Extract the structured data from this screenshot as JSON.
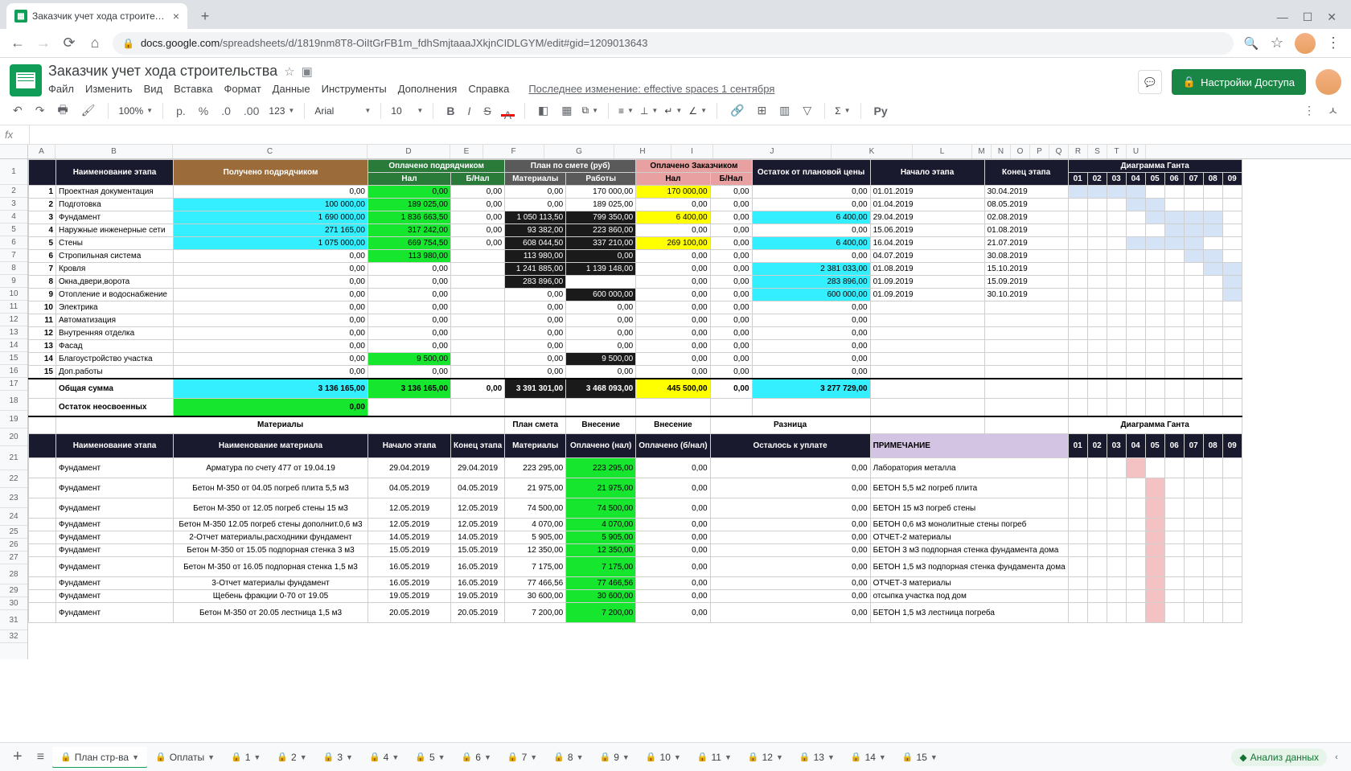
{
  "browser": {
    "tab_title": "Заказчик учет хода строительст",
    "url_host": "docs.google.com",
    "url_path": "/spreadsheets/d/1819nm8T8-OiItGrFB1m_fdhSmjtaaaJXkjnCIDLGYM/edit#gid=1209013643"
  },
  "doc": {
    "title": "Заказчик учет хода строительства",
    "menus": [
      "Файл",
      "Изменить",
      "Вид",
      "Вставка",
      "Формат",
      "Данные",
      "Инструменты",
      "Дополнения",
      "Справка"
    ],
    "last_edit": "Последнее изменение: effective spaces 1 сентября",
    "share": "Настройки Доступа"
  },
  "toolbar": {
    "zoom": "100%",
    "font": "Arial",
    "size": "10"
  },
  "cols": {
    "A": 34,
    "B": 146,
    "C": 242,
    "D": 103,
    "E": 41,
    "F": 76,
    "G": 87,
    "H": 71,
    "I": 52,
    "J": 147,
    "K": 101,
    "L": 74
  },
  "gantt_hdr": [
    "01",
    "02",
    "03",
    "04",
    "05",
    "06",
    "07",
    "08",
    "09"
  ],
  "gantt_w": 24,
  "header1": {
    "name": "Наименование этапа",
    "recv": "Получено подрядчиком",
    "paidc": "Оплачено подрядчиком",
    "plan": "План по смете (руб)",
    "paidz": "Оплачено Заказчиком",
    "rest": "Остаток от плановой цены",
    "start": "Начало этапа",
    "end": "Конец этапа",
    "gantt": "Диаграмма Ганта"
  },
  "header2": {
    "nal": "Нал",
    "bnal": "Б/Нал",
    "mat": "Материалы",
    "rab": "Работы"
  },
  "rows": [
    {
      "n": "1",
      "name": "Проектная документация",
      "recv": "0,00",
      "d": "0,00",
      "e": "0,00",
      "f": "0,00",
      "g": "170 000,00",
      "h": "170 000,00",
      "i": "0,00",
      "j": "0,00",
      "k": "01.01.2019",
      "l": "30.04.2019",
      "g1": [
        1,
        2,
        3,
        4
      ],
      "recv_c": "",
      "d_c": "c-green",
      "h_c": "c-yellow",
      "j_c": ""
    },
    {
      "n": "2",
      "name": "Подготовка",
      "recv": "100 000,00",
      "d": "189 025,00",
      "e": "0,00",
      "f": "0,00",
      "g": "189 025,00",
      "h": "0,00",
      "i": "0,00",
      "j": "0,00",
      "k": "01.04.2019",
      "l": "08.05.2019",
      "g1": [
        4,
        5
      ],
      "recv_c": "c-cyan",
      "d_c": "c-green",
      "h_c": "",
      "j_c": ""
    },
    {
      "n": "3",
      "name": "Фундамент",
      "recv": "1 690 000,00",
      "d": "1 836 663,50",
      "e": "0,00",
      "f": "1 050 113,50",
      "g": "799 350,00",
      "h": "6 400,00",
      "i": "0,00",
      "j": "6 400,00",
      "k": "29.04.2019",
      "l": "02.08.2019",
      "g1": [
        5,
        6,
        7,
        8
      ],
      "recv_c": "c-cyan",
      "d_c": "c-green",
      "f_c": "c-black",
      "g_c": "c-black",
      "h_c": "c-yellow",
      "j_c": "c-cyan"
    },
    {
      "n": "4",
      "name": "Наружные инженерные сети",
      "recv": "271 165,00",
      "d": "317 242,00",
      "e": "0,00",
      "f": "93 382,00",
      "g": "223 860,00",
      "h": "0,00",
      "i": "0,00",
      "j": "0,00",
      "k": "15.06.2019",
      "l": "01.08.2019",
      "g1": [
        6,
        7,
        8
      ],
      "recv_c": "c-cyan",
      "d_c": "c-green",
      "f_c": "c-black",
      "g_c": "c-black",
      "h_c": "",
      "j_c": ""
    },
    {
      "n": "5",
      "name": "Стены",
      "recv": "1 075 000,00",
      "d": "669 754,50",
      "e": "0,00",
      "f": "608 044,50",
      "g": "337 210,00",
      "h": "269 100,00",
      "i": "0,00",
      "j": "6 400,00",
      "k": "16.04.2019",
      "l": "21.07.2019",
      "g1": [
        4,
        5,
        6,
        7
      ],
      "recv_c": "c-cyan",
      "d_c": "c-green",
      "f_c": "c-black",
      "g_c": "c-black",
      "h_c": "c-yellow",
      "j_c": "c-cyan"
    },
    {
      "n": "6",
      "name": "Стропильная система",
      "recv": "0,00",
      "d": "113 980,00",
      "e": "",
      "f": "113 980,00",
      "g": "0,00",
      "h": "0,00",
      "i": "0,00",
      "j": "0,00",
      "k": "04.07.2019",
      "l": "30.08.2019",
      "g1": [
        7,
        8
      ],
      "recv_c": "",
      "d_c": "c-green",
      "f_c": "c-black",
      "g_c": "c-black",
      "h_c": "",
      "j_c": ""
    },
    {
      "n": "7",
      "name": "Кровля",
      "recv": "0,00",
      "d": "0,00",
      "e": "",
      "f": "1 241 885,00",
      "g": "1 139 148,00",
      "h": "0,00",
      "i": "0,00",
      "j": "2 381 033,00",
      "k": "01.08.2019",
      "l": "15.10.2019",
      "g1": [
        8,
        9
      ],
      "recv_c": "",
      "d_c": "",
      "f_c": "c-black",
      "g_c": "c-black",
      "h_c": "",
      "j_c": "c-cyan"
    },
    {
      "n": "8",
      "name": "Окна,двери,ворота",
      "recv": "0,00",
      "d": "0,00",
      "e": "",
      "f": "283 896,00",
      "g": "",
      "h": "0,00",
      "i": "0,00",
      "j": "283 896,00",
      "k": "01.09.2019",
      "l": "15.09.2019",
      "g1": [
        9
      ],
      "recv_c": "",
      "d_c": "",
      "f_c": "c-black",
      "g_c": "",
      "h_c": "",
      "j_c": "c-cyan"
    },
    {
      "n": "9",
      "name": "Отопление и водоснабжение",
      "recv": "0,00",
      "d": "0,00",
      "e": "",
      "f": "0,00",
      "g": "600 000,00",
      "h": "0,00",
      "i": "0,00",
      "j": "600 000,00",
      "k": "01.09.2019",
      "l": "30.10.2019",
      "g1": [
        9
      ],
      "recv_c": "",
      "d_c": "",
      "f_c": "",
      "g_c": "c-black",
      "h_c": "",
      "j_c": "c-cyan"
    },
    {
      "n": "10",
      "name": "Электрика",
      "recv": "0,00",
      "d": "0,00",
      "e": "",
      "f": "0,00",
      "g": "0,00",
      "h": "0,00",
      "i": "0,00",
      "j": "0,00",
      "k": "",
      "l": "",
      "g1": [],
      "recv_c": "",
      "d_c": "",
      "h_c": "",
      "j_c": ""
    },
    {
      "n": "11",
      "name": "Автоматизация",
      "recv": "0,00",
      "d": "0,00",
      "e": "",
      "f": "0,00",
      "g": "0,00",
      "h": "0,00",
      "i": "0,00",
      "j": "0,00",
      "k": "",
      "l": "",
      "g1": [],
      "recv_c": "",
      "d_c": "",
      "h_c": "",
      "j_c": ""
    },
    {
      "n": "12",
      "name": "Внутренняя отделка",
      "recv": "0,00",
      "d": "0,00",
      "e": "",
      "f": "0,00",
      "g": "0,00",
      "h": "0,00",
      "i": "0,00",
      "j": "0,00",
      "k": "",
      "l": "",
      "g1": [],
      "recv_c": "",
      "d_c": "",
      "h_c": "",
      "j_c": ""
    },
    {
      "n": "13",
      "name": "Фасад",
      "recv": "0,00",
      "d": "0,00",
      "e": "",
      "f": "0,00",
      "g": "0,00",
      "h": "0,00",
      "i": "0,00",
      "j": "0,00",
      "k": "",
      "l": "",
      "g1": [],
      "recv_c": "",
      "d_c": "",
      "h_c": "",
      "j_c": ""
    },
    {
      "n": "14",
      "name": "Благоустройство участка",
      "recv": "0,00",
      "d": "9 500,00",
      "e": "",
      "f": "0,00",
      "g": "9 500,00",
      "h": "0,00",
      "i": "0,00",
      "j": "0,00",
      "k": "",
      "l": "",
      "g1": [],
      "recv_c": "",
      "d_c": "c-green",
      "g_c": "c-black",
      "h_c": "",
      "j_c": ""
    },
    {
      "n": "15",
      "name": "Доп.работы",
      "recv": "0,00",
      "d": "0,00",
      "e": "",
      "f": "0,00",
      "g": "0,00",
      "h": "0,00",
      "i": "0,00",
      "j": "0,00",
      "k": "",
      "l": "",
      "g1": [],
      "recv_c": "",
      "d_c": "",
      "h_c": "",
      "j_c": ""
    }
  ],
  "sum": {
    "name": "Общая сумма",
    "recv": "3 136 165,00",
    "d": "3 136 165,00",
    "e": "0,00",
    "f": "3 391 301,00",
    "g": "3 468 093,00",
    "h": "445 500,00",
    "i": "0,00",
    "j": "3 277 729,00"
  },
  "rest": {
    "name": "Остаток неосвоенных",
    "recv": "0,00"
  },
  "sec2_hdr": {
    "mat": "Материалы",
    "plan": "План смета",
    "vn1": "Внесение",
    "vn2": "Внесение",
    "diff": "Разница",
    "gantt": "Диаграмма Ганта"
  },
  "sec2_hdr2": {
    "name": "Наименование этапа",
    "matname": "Наименование материала",
    "start": "Начало этапа",
    "end": "Конец этапа",
    "mat": "Материалы",
    "pnal": "Оплачено (нал)",
    "pbnal": "Оплачено (б/нал)",
    "left": "Осталось к уплате",
    "note": "ПРИМЕЧАНИЕ"
  },
  "mat_rows": [
    {
      "stage": "Фундамент",
      "mat": "Арматура по счету 477 от 19.04.19",
      "s": "29.04.2019",
      "e": "29.04.2019",
      "f": "223 295,00",
      "g": "223 295,00",
      "h": "0,00",
      "j": "0,00",
      "note": "Лаборатория металла",
      "g1": [
        4
      ],
      "h2": true
    },
    {
      "stage": "Фундамент",
      "mat": "Бетон М-350 от 04.05 погреб плита 5,5 м3",
      "s": "04.05.2019",
      "e": "04.05.2019",
      "f": "21 975,00",
      "g": "21 975,00",
      "h": "0,00",
      "j": "0,00",
      "note": "БЕТОН 5,5 м2 погреб плита",
      "g1": [
        5
      ],
      "h2": true
    },
    {
      "stage": "Фундамент",
      "mat": "Бетон М-350 от 12.05 погреб стены 15 м3",
      "s": "12.05.2019",
      "e": "12.05.2019",
      "f": "74 500,00",
      "g": "74 500,00",
      "h": "0,00",
      "j": "0,00",
      "note": "БЕТОН 15 м3 погреб стены",
      "g1": [
        5
      ],
      "h2": true
    },
    {
      "stage": "Фундамент",
      "mat": "Бетон М-350 12.05 погреб стены дополнит.0,6 м3",
      "s": "12.05.2019",
      "e": "12.05.2019",
      "f": "4 070,00",
      "g": "4 070,00",
      "h": "0,00",
      "j": "0,00",
      "note": "БЕТОН  0,6 м3 монолитные стены погреб",
      "g1": [
        5
      ]
    },
    {
      "stage": "Фундамент",
      "mat": "2-Отчет материалы,расходники фундамент",
      "s": "14.05.2019",
      "e": "14.05.2019",
      "f": "5 905,00",
      "g": "5 905,00",
      "h": "0,00",
      "j": "0,00",
      "note": "ОТЧЕТ-2 материалы",
      "g1": [
        5
      ]
    },
    {
      "stage": "Фундамент",
      "mat": "Бетон М-350 от 15.05 подпорная стенка 3 м3",
      "s": "15.05.2019",
      "e": "15.05.2019",
      "f": "12 350,00",
      "g": "12 350,00",
      "h": "0,00",
      "j": "0,00",
      "note": "БЕТОН 3 м3 подпорная стенка фундамента дома",
      "g1": [
        5
      ]
    },
    {
      "stage": "Фундамент",
      "mat": "Бетон М-350 от 16.05 подпорная стенка 1,5 м3",
      "s": "16.05.2019",
      "e": "16.05.2019",
      "f": "7 175,00",
      "g": "7 175,00",
      "h": "0,00",
      "j": "0,00",
      "note": "БЕТОН 1,5 м3 подпорная стенка фундамента дома",
      "g1": [
        5
      ],
      "h2": true
    },
    {
      "stage": "Фундамент",
      "mat": "3-Отчет материалы  фундамент",
      "s": "16.05.2019",
      "e": "16.05.2019",
      "f": "77 466,56",
      "g": "77 466,56",
      "h": "0,00",
      "j": "0,00",
      "note": "ОТЧЕТ-3 материалы",
      "g1": [
        5
      ]
    },
    {
      "stage": "Фундамент",
      "mat": "Щебень фракции 0-70 от 19.05",
      "s": "19.05.2019",
      "e": "19.05.2019",
      "f": "30 600,00",
      "g": "30 600,00",
      "h": "0,00",
      "j": "0,00",
      "note": "отсыпка участка под дом",
      "g1": [
        5
      ]
    },
    {
      "stage": "Фундамент",
      "mat": "Бетон М-350 от 20.05 лестница 1,5 м3",
      "s": "20.05.2019",
      "e": "20.05.2019",
      "f": "7 200,00",
      "g": "7 200,00",
      "h": "0,00",
      "j": "0,00",
      "note": "БЕТОН 1,5 м3 лестница погреба",
      "g1": [
        5
      ],
      "h2": true
    }
  ],
  "sheets": [
    {
      "name": "План стр-ва",
      "active": true
    },
    {
      "name": "Оплаты"
    },
    {
      "name": "1"
    },
    {
      "name": "2"
    },
    {
      "name": "3"
    },
    {
      "name": "4"
    },
    {
      "name": "5"
    },
    {
      "name": "6"
    },
    {
      "name": "7"
    },
    {
      "name": "8"
    },
    {
      "name": "9"
    },
    {
      "name": "10"
    },
    {
      "name": "11"
    },
    {
      "name": "12"
    },
    {
      "name": "13"
    },
    {
      "name": "14"
    },
    {
      "name": "15"
    }
  ],
  "explore": "Анализ данных"
}
